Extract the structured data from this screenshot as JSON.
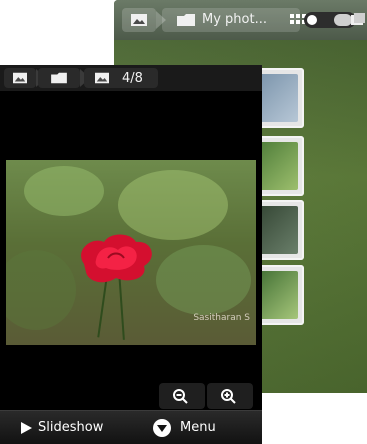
{
  "back": {
    "breadcrumb_label": "My phot...",
    "icons": [
      "image-icon",
      "folder-icon",
      "grid-icon",
      "toggle-icon",
      "stack-icon"
    ]
  },
  "front": {
    "counter": "4/8",
    "photo_watermark": "Sasitharan S",
    "bottom": {
      "slideshow": "Slideshow",
      "menu": "Menu"
    },
    "zoom": {
      "out": "zoom-out",
      "in": "zoom-in"
    }
  },
  "colors": {
    "accent": "#d40f2f",
    "front_bg": "#000000",
    "back_bg": "#4d6a2f"
  }
}
